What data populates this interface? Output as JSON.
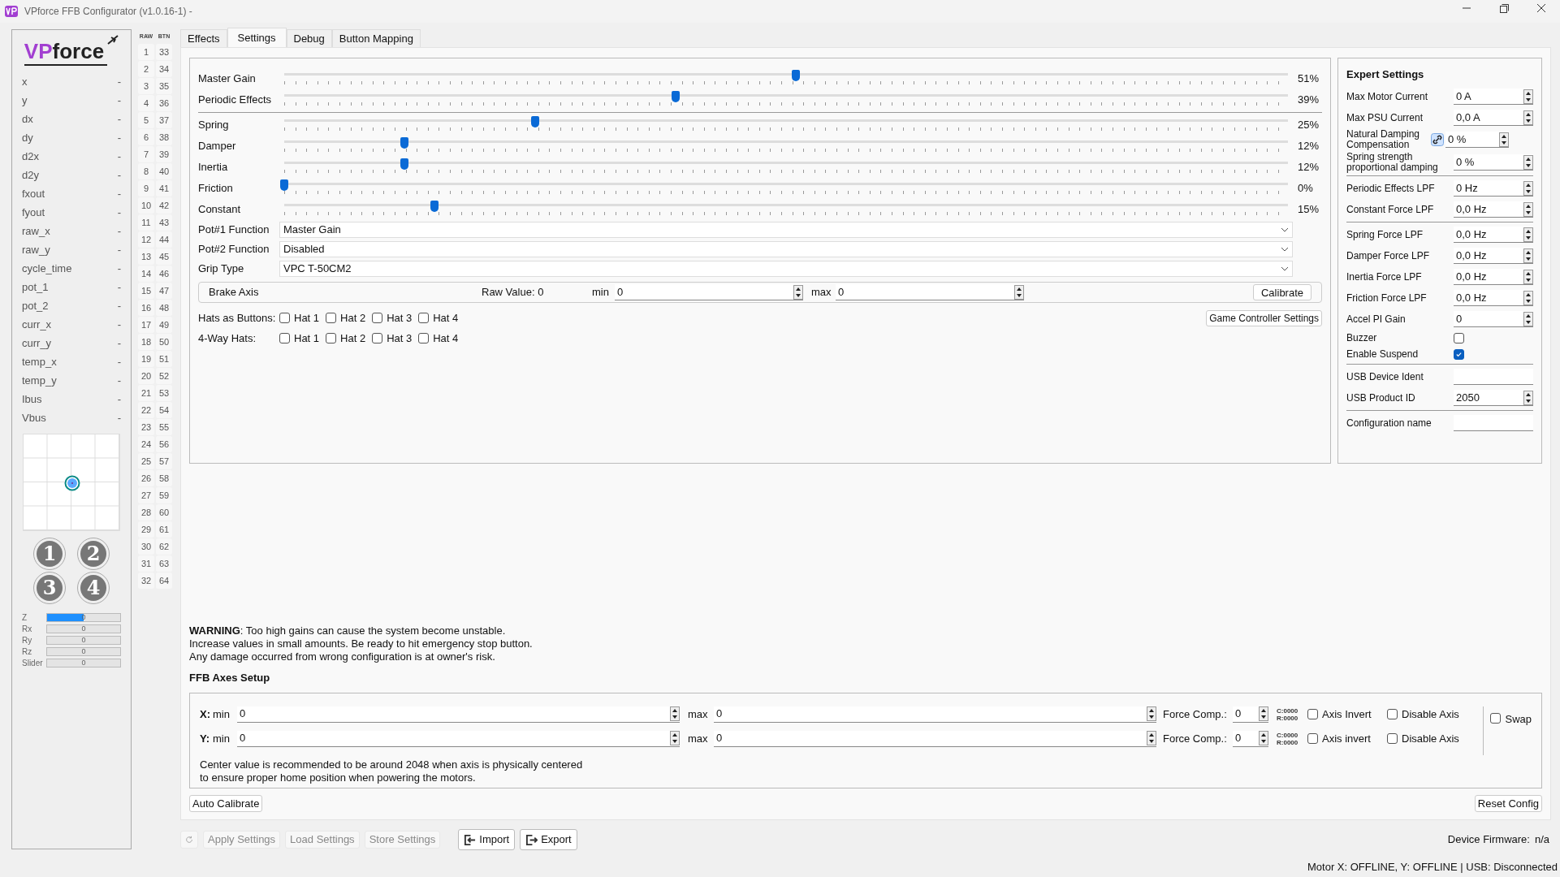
{
  "window": {
    "title": "VPforce FFB Configurator (v1.0.16-1) -"
  },
  "sidebar": {
    "logo": {
      "part_1": "VP",
      "part_2": "force"
    },
    "readouts": [
      {
        "label": "x",
        "value": "-"
      },
      {
        "label": "y",
        "value": "-"
      },
      {
        "label": "dx",
        "value": "-"
      },
      {
        "label": "dy",
        "value": "-"
      },
      {
        "label": "d2x",
        "value": "-"
      },
      {
        "label": "d2y",
        "value": "-"
      },
      {
        "label": "fxout",
        "value": "-"
      },
      {
        "label": "fyout",
        "value": "-"
      },
      {
        "label": "raw_x",
        "value": "-"
      },
      {
        "label": "raw_y",
        "value": "-"
      },
      {
        "label": "cycle_time",
        "value": "-"
      },
      {
        "label": "pot_1",
        "value": "-"
      },
      {
        "label": "pot_2",
        "value": "-"
      },
      {
        "label": "curr_x",
        "value": "-"
      },
      {
        "label": "curr_y",
        "value": "-"
      },
      {
        "label": "temp_x",
        "value": "-"
      },
      {
        "label": "temp_y",
        "value": "-"
      },
      {
        "label": "Ibus",
        "value": "-"
      },
      {
        "label": "Vbus",
        "value": "-"
      }
    ],
    "hat_buttons": [
      "1",
      "2",
      "3",
      "4"
    ],
    "axes": [
      {
        "label": "Z",
        "value": "0",
        "level": 0.5
      },
      {
        "label": "Rx",
        "value": "0",
        "level": 0
      },
      {
        "label": "Ry",
        "value": "0",
        "level": 0
      },
      {
        "label": "Rz",
        "value": "0",
        "level": 0
      },
      {
        "label": "Slider",
        "value": "0",
        "level": 0
      }
    ]
  },
  "button_grid": {
    "headers": [
      "RAW",
      "BTN"
    ],
    "rows": [
      {
        "raw": "1",
        "btn": "33"
      },
      {
        "raw": "2",
        "btn": "34"
      },
      {
        "raw": "3",
        "btn": "35"
      },
      {
        "raw": "4",
        "btn": "36"
      },
      {
        "raw": "5",
        "btn": "37"
      },
      {
        "raw": "6",
        "btn": "38"
      },
      {
        "raw": "7",
        "btn": "39"
      },
      {
        "raw": "8",
        "btn": "40"
      },
      {
        "raw": "9",
        "btn": "41"
      },
      {
        "raw": "10",
        "btn": "42"
      },
      {
        "raw": "11",
        "btn": "43"
      },
      {
        "raw": "12",
        "btn": "44"
      },
      {
        "raw": "13",
        "btn": "45"
      },
      {
        "raw": "14",
        "btn": "46"
      },
      {
        "raw": "15",
        "btn": "47"
      },
      {
        "raw": "16",
        "btn": "48"
      },
      {
        "raw": "17",
        "btn": "49"
      },
      {
        "raw": "18",
        "btn": "50"
      },
      {
        "raw": "19",
        "btn": "51"
      },
      {
        "raw": "20",
        "btn": "52"
      },
      {
        "raw": "21",
        "btn": "53"
      },
      {
        "raw": "22",
        "btn": "54"
      },
      {
        "raw": "23",
        "btn": "55"
      },
      {
        "raw": "24",
        "btn": "56"
      },
      {
        "raw": "25",
        "btn": "57"
      },
      {
        "raw": "26",
        "btn": "58"
      },
      {
        "raw": "27",
        "btn": "59"
      },
      {
        "raw": "28",
        "btn": "60"
      },
      {
        "raw": "29",
        "btn": "61"
      },
      {
        "raw": "30",
        "btn": "62"
      },
      {
        "raw": "31",
        "btn": "63"
      },
      {
        "raw": "32",
        "btn": "64"
      }
    ]
  },
  "tabs": [
    {
      "label": "Effects",
      "selected": false
    },
    {
      "label": "Settings",
      "selected": true
    },
    {
      "label": "Debug",
      "selected": false
    },
    {
      "label": "Button Mapping",
      "selected": false
    }
  ],
  "gain_sliders": [
    {
      "label": "Master Gain",
      "level": 0.51,
      "reading": "51%"
    },
    {
      "label": "Periodic Effects",
      "level": 0.39,
      "reading": "39%"
    }
  ],
  "effect_sliders": [
    {
      "label": "Spring",
      "level": 0.25,
      "reading": "25%"
    },
    {
      "label": "Damper",
      "level": 0.12,
      "reading": "12%"
    },
    {
      "label": "Inertia",
      "level": 0.12,
      "reading": "12%"
    },
    {
      "label": "Friction",
      "level": 0,
      "reading": "0%"
    },
    {
      "label": "Constant",
      "level": 0.15,
      "reading": "15%"
    }
  ],
  "dropdowns": [
    {
      "label": "Pot#1 Function",
      "value": "Master Gain"
    },
    {
      "label": "Pot#2 Function",
      "value": "Disabled"
    },
    {
      "label": "Grip Type",
      "value": "VPC T-50CM2"
    }
  ],
  "brake_axis": {
    "label": "Brake Axis",
    "raw_value": "Raw Value: 0",
    "min_label": "min",
    "min": "0",
    "max_label": "max",
    "max": "0",
    "button": "Calibrate"
  },
  "hat_groups": [
    {
      "label": "Hats as Buttons:",
      "options": [
        {
          "label": "Hat 1",
          "checked": false
        },
        {
          "label": "Hat 2",
          "checked": false
        },
        {
          "label": "Hat 3",
          "checked": false
        },
        {
          "label": "Hat 4",
          "checked": false
        }
      ]
    },
    {
      "label": "4-Way Hats:",
      "options": [
        {
          "label": "Hat 1",
          "checked": false
        },
        {
          "label": "Hat 2",
          "checked": false
        },
        {
          "label": "Hat 3",
          "checked": false
        },
        {
          "label": "Hat 4",
          "checked": false
        }
      ]
    }
  ],
  "game_controller_button": "Game Controller Settings",
  "expert": {
    "title": "Expert Settings",
    "groups": [
      [
        {
          "kind": "spin",
          "label": "Max Motor Current",
          "value": "0 A"
        },
        {
          "kind": "spin",
          "label": "Max PSU Current",
          "value": "0,0 A"
        },
        {
          "kind": "spin_link",
          "label": "Natural Damping Compensation",
          "value": "0 %"
        },
        {
          "kind": "spin",
          "label": "Spring strength proportional damping",
          "value": "0 %"
        }
      ],
      [
        {
          "kind": "spin",
          "label": "Periodic Effects LPF",
          "value": "0 Hz"
        },
        {
          "kind": "spin",
          "label": "Constant Force LPF",
          "value": "0,0 Hz"
        }
      ],
      [
        {
          "kind": "spin",
          "label": "Spring Force LPF",
          "value": "0,0 Hz"
        },
        {
          "kind": "spin",
          "label": "Damper Force LPF",
          "value": "0,0 Hz"
        },
        {
          "kind": "spin",
          "label": "Inertia Force LPF",
          "value": "0,0 Hz"
        },
        {
          "kind": "spin",
          "label": "Friction Force LPF",
          "value": "0,0 Hz"
        },
        {
          "kind": "spin",
          "label": "Accel PI Gain",
          "value": "0"
        },
        {
          "kind": "check",
          "label": "Buzzer",
          "checked": false
        },
        {
          "kind": "check",
          "label": "Enable Suspend",
          "checked": true
        }
      ],
      [
        {
          "kind": "text",
          "label": "USB Device Ident"
        },
        {
          "kind": "spin",
          "label": "USB Product ID",
          "value": "2050"
        }
      ],
      [
        {
          "kind": "text",
          "label": "Configuration name"
        }
      ]
    ]
  },
  "warning": [
    "**WARNING**: Too high gains can cause the system become unstable.",
    "Increase values in small amounts. Be ready to hit emergency stop button.",
    "Any damage occurred from wrong configuration is at owner's risk."
  ],
  "ffb_axes": {
    "title": "FFB Axes Setup",
    "rows": [
      {
        "axis": "X:",
        "min_label": "min",
        "min": "0",
        "max_label": "max",
        "max": "0",
        "force_label": "Force Comp.:",
        "force": "0",
        "center": "C:0000",
        "range": "R:0000",
        "invert": {
          "label": "Axis Invert",
          "checked": false
        },
        "disable": {
          "label": "Disable Axis",
          "checked": false
        }
      },
      {
        "axis": "Y:",
        "min_label": "min",
        "min": "0",
        "max_label": "max",
        "max": "0",
        "force_label": "Force Comp.:",
        "force": "0",
        "center": "C:0000",
        "range": "R:0000",
        "invert": {
          "label": "Axis invert",
          "checked": false
        },
        "disable": {
          "label": "Disable Axis",
          "checked": false
        }
      }
    ],
    "swap": {
      "label": "Swap",
      "checked": false
    },
    "note": [
      "Center value is recommended to be around 2048 when axis is physically centered",
      "to ensure proper home position when powering the motors."
    ]
  },
  "auto_calibrate": "Auto Calibrate",
  "reset_config": "Reset Config",
  "toolbar": [
    {
      "kind": "refresh",
      "disabled": true
    },
    {
      "kind": "text",
      "label": "Apply Settings",
      "disabled": true
    },
    {
      "kind": "text",
      "label": "Load Settings",
      "disabled": true
    },
    {
      "kind": "text",
      "label": "Store Settings",
      "disabled": true
    },
    {
      "kind": "import",
      "label": "Import",
      "disabled": false
    },
    {
      "kind": "export",
      "label": "Export",
      "disabled": false
    }
  ],
  "firmware": {
    "label": "Device Firmware:",
    "value": "n/a"
  },
  "status": "Motor X: OFFLINE, Y: OFFLINE | USB: Disconnected"
}
